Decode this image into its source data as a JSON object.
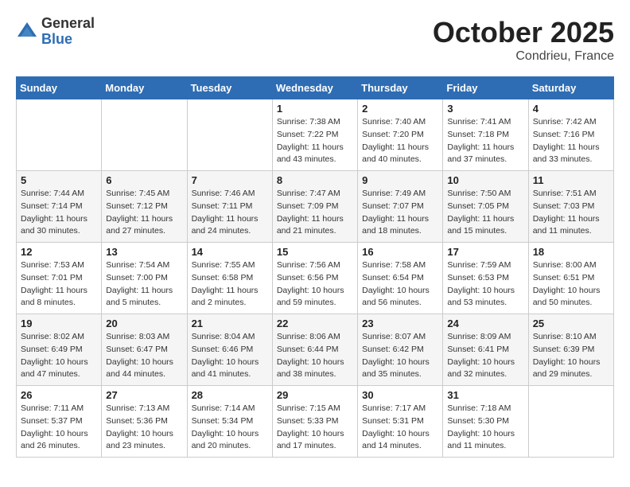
{
  "header": {
    "logo_line1": "General",
    "logo_line2": "Blue",
    "month": "October 2025",
    "location": "Condrieu, France"
  },
  "weekdays": [
    "Sunday",
    "Monday",
    "Tuesday",
    "Wednesday",
    "Thursday",
    "Friday",
    "Saturday"
  ],
  "weeks": [
    [
      {
        "day": "",
        "info": ""
      },
      {
        "day": "",
        "info": ""
      },
      {
        "day": "",
        "info": ""
      },
      {
        "day": "1",
        "info": "Sunrise: 7:38 AM\nSunset: 7:22 PM\nDaylight: 11 hours\nand 43 minutes."
      },
      {
        "day": "2",
        "info": "Sunrise: 7:40 AM\nSunset: 7:20 PM\nDaylight: 11 hours\nand 40 minutes."
      },
      {
        "day": "3",
        "info": "Sunrise: 7:41 AM\nSunset: 7:18 PM\nDaylight: 11 hours\nand 37 minutes."
      },
      {
        "day": "4",
        "info": "Sunrise: 7:42 AM\nSunset: 7:16 PM\nDaylight: 11 hours\nand 33 minutes."
      }
    ],
    [
      {
        "day": "5",
        "info": "Sunrise: 7:44 AM\nSunset: 7:14 PM\nDaylight: 11 hours\nand 30 minutes."
      },
      {
        "day": "6",
        "info": "Sunrise: 7:45 AM\nSunset: 7:12 PM\nDaylight: 11 hours\nand 27 minutes."
      },
      {
        "day": "7",
        "info": "Sunrise: 7:46 AM\nSunset: 7:11 PM\nDaylight: 11 hours\nand 24 minutes."
      },
      {
        "day": "8",
        "info": "Sunrise: 7:47 AM\nSunset: 7:09 PM\nDaylight: 11 hours\nand 21 minutes."
      },
      {
        "day": "9",
        "info": "Sunrise: 7:49 AM\nSunset: 7:07 PM\nDaylight: 11 hours\nand 18 minutes."
      },
      {
        "day": "10",
        "info": "Sunrise: 7:50 AM\nSunset: 7:05 PM\nDaylight: 11 hours\nand 15 minutes."
      },
      {
        "day": "11",
        "info": "Sunrise: 7:51 AM\nSunset: 7:03 PM\nDaylight: 11 hours\nand 11 minutes."
      }
    ],
    [
      {
        "day": "12",
        "info": "Sunrise: 7:53 AM\nSunset: 7:01 PM\nDaylight: 11 hours\nand 8 minutes."
      },
      {
        "day": "13",
        "info": "Sunrise: 7:54 AM\nSunset: 7:00 PM\nDaylight: 11 hours\nand 5 minutes."
      },
      {
        "day": "14",
        "info": "Sunrise: 7:55 AM\nSunset: 6:58 PM\nDaylight: 11 hours\nand 2 minutes."
      },
      {
        "day": "15",
        "info": "Sunrise: 7:56 AM\nSunset: 6:56 PM\nDaylight: 10 hours\nand 59 minutes."
      },
      {
        "day": "16",
        "info": "Sunrise: 7:58 AM\nSunset: 6:54 PM\nDaylight: 10 hours\nand 56 minutes."
      },
      {
        "day": "17",
        "info": "Sunrise: 7:59 AM\nSunset: 6:53 PM\nDaylight: 10 hours\nand 53 minutes."
      },
      {
        "day": "18",
        "info": "Sunrise: 8:00 AM\nSunset: 6:51 PM\nDaylight: 10 hours\nand 50 minutes."
      }
    ],
    [
      {
        "day": "19",
        "info": "Sunrise: 8:02 AM\nSunset: 6:49 PM\nDaylight: 10 hours\nand 47 minutes."
      },
      {
        "day": "20",
        "info": "Sunrise: 8:03 AM\nSunset: 6:47 PM\nDaylight: 10 hours\nand 44 minutes."
      },
      {
        "day": "21",
        "info": "Sunrise: 8:04 AM\nSunset: 6:46 PM\nDaylight: 10 hours\nand 41 minutes."
      },
      {
        "day": "22",
        "info": "Sunrise: 8:06 AM\nSunset: 6:44 PM\nDaylight: 10 hours\nand 38 minutes."
      },
      {
        "day": "23",
        "info": "Sunrise: 8:07 AM\nSunset: 6:42 PM\nDaylight: 10 hours\nand 35 minutes."
      },
      {
        "day": "24",
        "info": "Sunrise: 8:09 AM\nSunset: 6:41 PM\nDaylight: 10 hours\nand 32 minutes."
      },
      {
        "day": "25",
        "info": "Sunrise: 8:10 AM\nSunset: 6:39 PM\nDaylight: 10 hours\nand 29 minutes."
      }
    ],
    [
      {
        "day": "26",
        "info": "Sunrise: 7:11 AM\nSunset: 5:37 PM\nDaylight: 10 hours\nand 26 minutes."
      },
      {
        "day": "27",
        "info": "Sunrise: 7:13 AM\nSunset: 5:36 PM\nDaylight: 10 hours\nand 23 minutes."
      },
      {
        "day": "28",
        "info": "Sunrise: 7:14 AM\nSunset: 5:34 PM\nDaylight: 10 hours\nand 20 minutes."
      },
      {
        "day": "29",
        "info": "Sunrise: 7:15 AM\nSunset: 5:33 PM\nDaylight: 10 hours\nand 17 minutes."
      },
      {
        "day": "30",
        "info": "Sunrise: 7:17 AM\nSunset: 5:31 PM\nDaylight: 10 hours\nand 14 minutes."
      },
      {
        "day": "31",
        "info": "Sunrise: 7:18 AM\nSunset: 5:30 PM\nDaylight: 10 hours\nand 11 minutes."
      },
      {
        "day": "",
        "info": ""
      }
    ]
  ]
}
